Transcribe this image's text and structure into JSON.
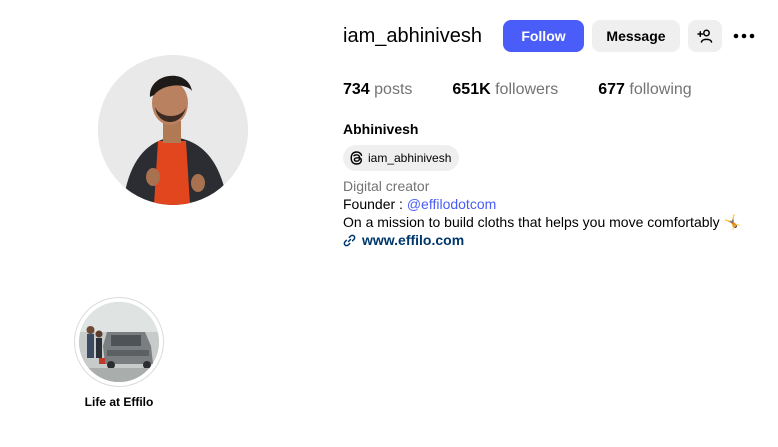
{
  "profile": {
    "username": "iam_abhinivesh",
    "full_name": "Abhinivesh",
    "threads_handle": "iam_abhinivesh",
    "category": "Digital creator",
    "bio_founder_prefix": "Founder : ",
    "bio_founder_mention": "@effilodotcom",
    "bio_mission": "On a mission to build cloths that helps you move comfortably 🤸",
    "website": "www.effilo.com"
  },
  "actions": {
    "follow_label": "Follow",
    "message_label": "Message",
    "add_user_icon": "person-add-icon",
    "more_icon": "more-horizontal-icon"
  },
  "stats": {
    "posts_count": "734",
    "posts_label": "posts",
    "followers_count": "651K",
    "followers_label": "followers",
    "following_count": "677",
    "following_label": "following"
  },
  "highlights": [
    {
      "label": "Life at Effilo"
    }
  ],
  "colors": {
    "follow_button": "#4a5df9",
    "secondary_button": "#efefef",
    "muted_text": "#737373",
    "link_text": "#00376b",
    "mention_text": "#4a5df9"
  }
}
